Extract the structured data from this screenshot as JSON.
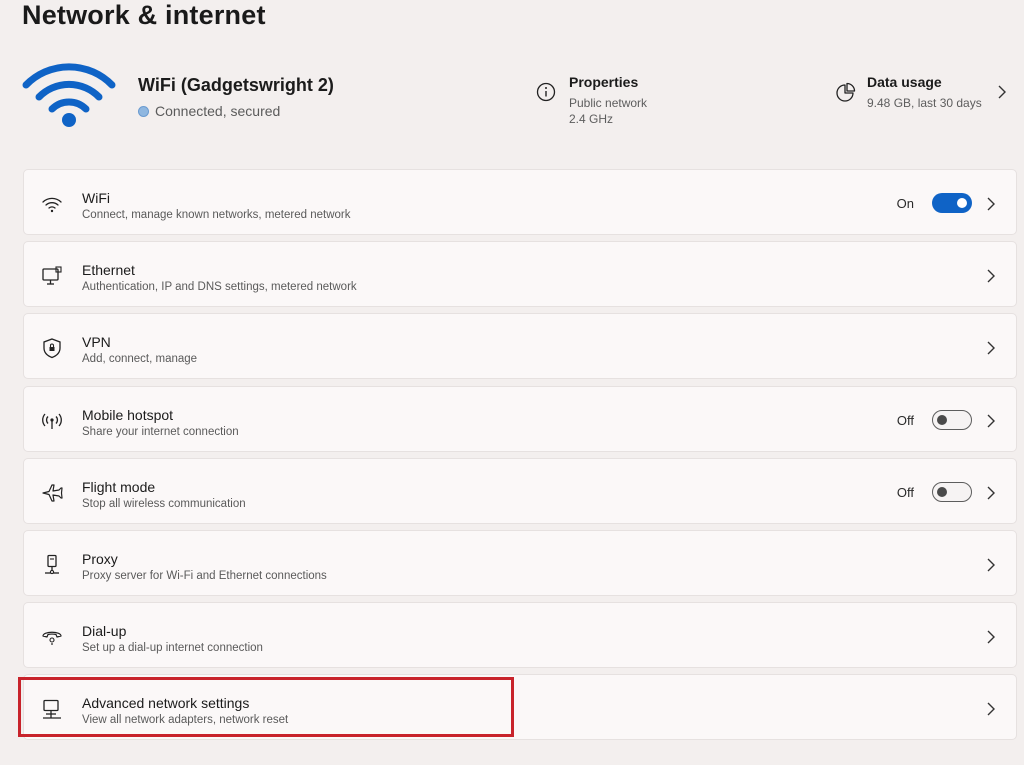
{
  "page": {
    "title": "Network & internet"
  },
  "header": {
    "network_name": "WiFi (Gadgetswright 2)",
    "status": "Connected, secured",
    "properties": {
      "title": "Properties",
      "line1": "Public network",
      "line2": "2.4 GHz"
    },
    "data_usage": {
      "title": "Data usage",
      "line1": "9.48 GB, last 30 days"
    }
  },
  "rows": [
    {
      "title": "WiFi",
      "subtitle": "Connect, manage known networks, metered network",
      "icon": "wifi-icon",
      "state": "On",
      "toggle": "on"
    },
    {
      "title": "Ethernet",
      "subtitle": "Authentication, IP and DNS settings, metered network",
      "icon": "ethernet-icon"
    },
    {
      "title": "VPN",
      "subtitle": "Add, connect, manage",
      "icon": "shield-icon"
    },
    {
      "title": "Mobile hotspot",
      "subtitle": "Share your internet connection",
      "icon": "hotspot-icon",
      "state": "Off",
      "toggle": "off"
    },
    {
      "title": "Flight mode",
      "subtitle": "Stop all wireless communication",
      "icon": "airplane-icon",
      "state": "Off",
      "toggle": "off"
    },
    {
      "title": "Proxy",
      "subtitle": "Proxy server for Wi-Fi and Ethernet connections",
      "icon": "proxy-icon"
    },
    {
      "title": "Dial-up",
      "subtitle": "Set up a dial-up internet connection",
      "icon": "dialup-icon"
    },
    {
      "title": "Advanced network settings",
      "subtitle": "View all network adapters, network reset",
      "icon": "network-adapter-icon"
    }
  ],
  "colors": {
    "accent": "#0f63c6",
    "highlight": "#c8232b"
  }
}
